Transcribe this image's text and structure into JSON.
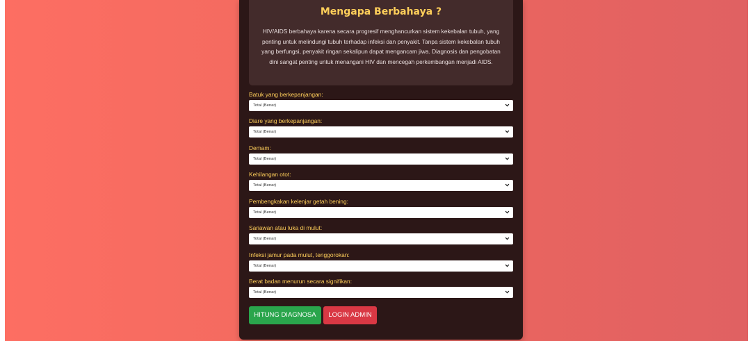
{
  "info": {
    "title": "Mengapa Berbahaya ?",
    "text": "HIV/AIDS berbahaya karena secara progresif menghancurkan sistem kekebalan tubuh, yang penting untuk melindungi tubuh terhadap infeksi dan penyakit. Tanpa sistem kekebalan tubuh yang berfungsi, penyakit ringan sekalipun dapat mengancam jiwa. Diagnosis dan pengobatan dini sangat penting untuk menangani HIV dan mencegah perkembangan menjadi AIDS."
  },
  "questions": [
    {
      "label": "Batuk yang berkepanjangan:",
      "value": "Total (Benar)"
    },
    {
      "label": "Diare yang berkepanjangan:",
      "value": "Total (Benar)"
    },
    {
      "label": "Demam:",
      "value": "Total (Benar)"
    },
    {
      "label": "Kehilangan otot:",
      "value": "Total (Benar)"
    },
    {
      "label": "Pembengkakan kelenjar getah bening:",
      "value": "Total (Benar)"
    },
    {
      "label": "Sariawan atau luka di mulut:",
      "value": "Total (Benar)"
    },
    {
      "label": "Infeksi jamur pada mulut, tenggorokan:",
      "value": "Total (Benar)"
    },
    {
      "label": "Berat badan menurun secara signifikan:",
      "value": "Total (Benar)"
    }
  ],
  "buttons": {
    "diagnose": "HITUNG DIAGNOSA",
    "admin": "LOGIN ADMIN"
  },
  "colors": {
    "accent": "#ffcf5a",
    "card": "#2c1717",
    "primary_button": "#2aa54c",
    "secondary_button": "#d93844"
  }
}
